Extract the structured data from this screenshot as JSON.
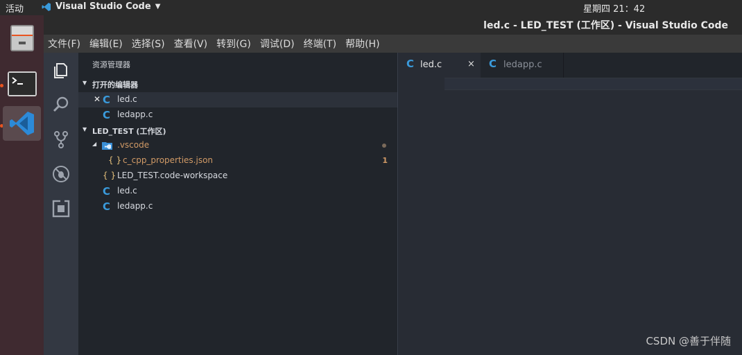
{
  "topbar": {
    "activities": "活动",
    "app_name": "Visual Studio Code",
    "clock": "星期四 21：42"
  },
  "dock": {
    "items": [
      {
        "name": "file-cabinet-icon"
      },
      {
        "name": "terminal-icon"
      },
      {
        "name": "vscode-icon"
      }
    ]
  },
  "window": {
    "title": "led.c - LED_TEST (工作区) - Visual Studio Code"
  },
  "menu": [
    "文件(F)",
    "编辑(E)",
    "选择(S)",
    "查看(V)",
    "转到(G)",
    "调试(D)",
    "终端(T)",
    "帮助(H)"
  ],
  "sidebar": {
    "title": "资源管理器",
    "open_editors_label": "打开的编辑器",
    "open_editors": [
      "led.c",
      "ledapp.c"
    ],
    "workspace_label": "LED_TEST (工作区)",
    "folder": ".vscode",
    "folder_file": "c_cpp_properties.json",
    "folder_file_problems": "1",
    "files": [
      "LED_TEST.code-workspace",
      "led.c",
      "ledapp.c"
    ]
  },
  "editor": {
    "tabs": [
      "led.c",
      "ledapp.c"
    ],
    "close_glyph": "×"
  },
  "watermark": "CSDN @善于伴随",
  "colors": {
    "c_icon": "#3a9bdc",
    "json_icon": "#e5c07b",
    "modified": "#d19a66",
    "dock_indicator": "#e95420"
  }
}
